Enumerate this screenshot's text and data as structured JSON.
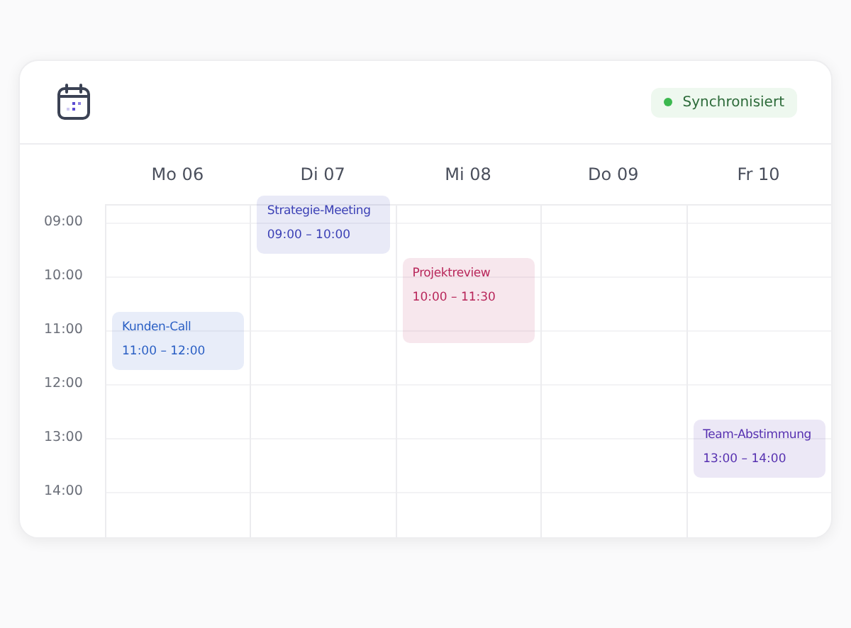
{
  "header": {
    "status": "Synchronisiert"
  },
  "time_labels": [
    "09:00",
    "10:00",
    "11:00",
    "12:00",
    "13:00",
    "14:00"
  ],
  "days": [
    {
      "label": "Mo 06",
      "events": [
        {
          "title": "Kunden-Call",
          "time": "11:00 – 12:00",
          "color": "#2a5fc4"
        }
      ]
    },
    {
      "label": "Di 07",
      "events": [
        {
          "title": "Strategie-Meeting",
          "time": "09:00 – 10:00",
          "color": "#3a3fb5"
        }
      ]
    },
    {
      "label": "Mi 08",
      "events": [
        {
          "title": "Projektreview",
          "time": "10:00 – 11:30",
          "color": "#b8265a"
        }
      ]
    },
    {
      "label": "Do 09"
    },
    {
      "label": "Fr 10",
      "events": [
        {
          "title": "Team-Abstimmung",
          "time": "13:00 – 14:00",
          "color": "#5630b0"
        }
      ]
    }
  ]
}
